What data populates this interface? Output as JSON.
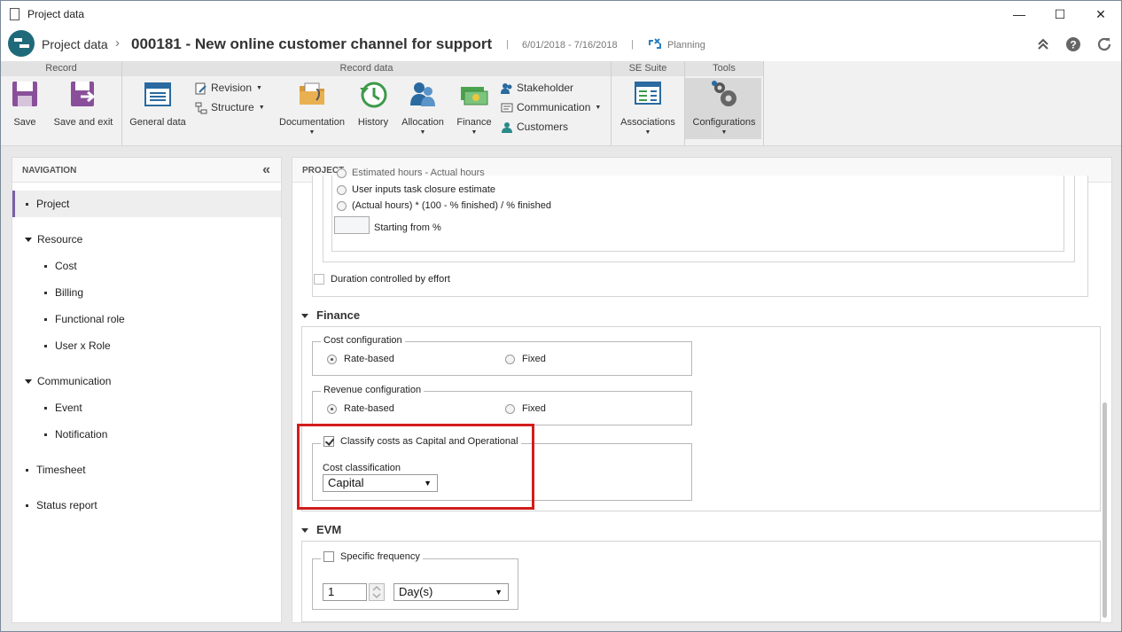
{
  "window": {
    "title": "Project data",
    "minimize": "—",
    "maximize": "☐",
    "close": "✕"
  },
  "header": {
    "app": "Project data",
    "separator": "›",
    "title": "000181 - New online customer channel for support",
    "bar": "|",
    "dates": "6/01/2018 - 7/16/2018",
    "status": "Planning"
  },
  "ribbon": {
    "groups": {
      "record": "Record",
      "record_data": "Record data",
      "se_suite": "SE Suite",
      "tools": "Tools"
    },
    "save": "Save",
    "save_exit": "Save and exit",
    "general_data": "General data",
    "revision": "Revision",
    "structure": "Structure",
    "documentation": "Documentation",
    "history": "History",
    "allocation": "Allocation",
    "finance": "Finance",
    "stakeholder": "Stakeholder",
    "communication": "Communication",
    "customers": "Customers",
    "associations": "Associations",
    "configurations": "Configurations",
    "dropdown": "▼"
  },
  "navigation": {
    "title": "NAVIGATION",
    "collapse": "«",
    "items": [
      {
        "label": "Project",
        "type": "bullet",
        "level": 0
      },
      {
        "label": "Resource",
        "type": "group",
        "level": 0
      },
      {
        "label": "Cost",
        "type": "bullet",
        "level": 1
      },
      {
        "label": "Billing",
        "type": "bullet",
        "level": 1
      },
      {
        "label": "Functional role",
        "type": "bullet",
        "level": 1
      },
      {
        "label": "User x Role",
        "type": "bullet",
        "level": 1
      },
      {
        "label": "Communication",
        "type": "group",
        "level": 0
      },
      {
        "label": "Event",
        "type": "bullet",
        "level": 1
      },
      {
        "label": "Notification",
        "type": "bullet",
        "level": 1
      },
      {
        "label": "Timesheet",
        "type": "bullet",
        "level": 0
      },
      {
        "label": "Status report",
        "type": "bullet",
        "level": 0
      }
    ]
  },
  "main": {
    "title": "PROJECT",
    "estimate": {
      "cut_option": "Estimated hours - Actual hours",
      "option_user_inputs": "User inputs task closure estimate",
      "option_formula": "(Actual hours) * (100 - % finished) / % finished",
      "starting_from_value": "",
      "starting_from_label": "Starting from %"
    },
    "duration_controlled_by_effort": {
      "label": "Duration controlled by effort",
      "checked": false
    },
    "finance": {
      "title": "Finance",
      "cost_configuration": {
        "legend": "Cost configuration",
        "option_rate": "Rate-based",
        "option_fixed": "Fixed",
        "selected": "Rate-based"
      },
      "revenue_configuration": {
        "legend": "Revenue configuration",
        "option_rate": "Rate-based",
        "option_fixed": "Fixed",
        "selected": "Rate-based"
      },
      "classify": {
        "label": "Classify costs as Capital and Operational",
        "checked": true
      },
      "cost_classification": {
        "label": "Cost classification",
        "value": "Capital"
      }
    },
    "evm": {
      "title": "EVM",
      "specific_frequency": {
        "label": "Specific frequency",
        "checked": false
      },
      "frequency_value": "1",
      "frequency_unit": "Day(s)"
    }
  },
  "colors": {
    "accent": "#7b5ea7",
    "highlight": "#d21d1d",
    "logo": "#1f6a7a"
  }
}
